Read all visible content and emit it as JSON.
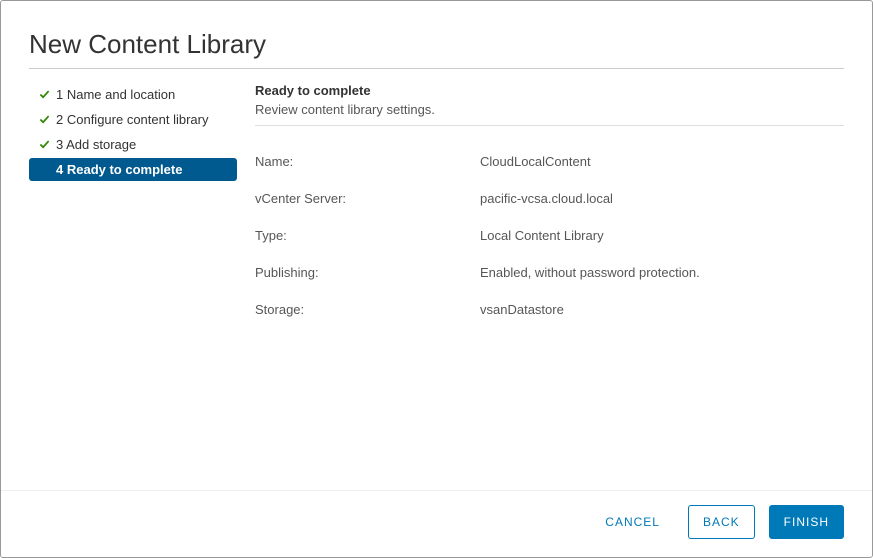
{
  "title": "New Content Library",
  "steps": [
    {
      "label": "1 Name and location",
      "done": true,
      "active": false
    },
    {
      "label": "2 Configure content library",
      "done": true,
      "active": false
    },
    {
      "label": "3 Add storage",
      "done": true,
      "active": false
    },
    {
      "label": "4 Ready to complete",
      "done": false,
      "active": true
    }
  ],
  "section": {
    "title": "Ready to complete",
    "subtitle": "Review content library settings."
  },
  "summary": [
    {
      "label": "Name:",
      "value": "CloudLocalContent"
    },
    {
      "label": "vCenter Server:",
      "value": "pacific-vcsa.cloud.local"
    },
    {
      "label": "Type:",
      "value": "Local Content Library"
    },
    {
      "label": "Publishing:",
      "value": "Enabled, without password protection."
    },
    {
      "label": "Storage:",
      "value": " vsanDatastore"
    }
  ],
  "buttons": {
    "cancel": "CANCEL",
    "back": "BACK",
    "finish": "FINISH"
  },
  "colors": {
    "accent": "#0079b8",
    "stepActive": "#015a8f",
    "check": "#2f8400"
  }
}
